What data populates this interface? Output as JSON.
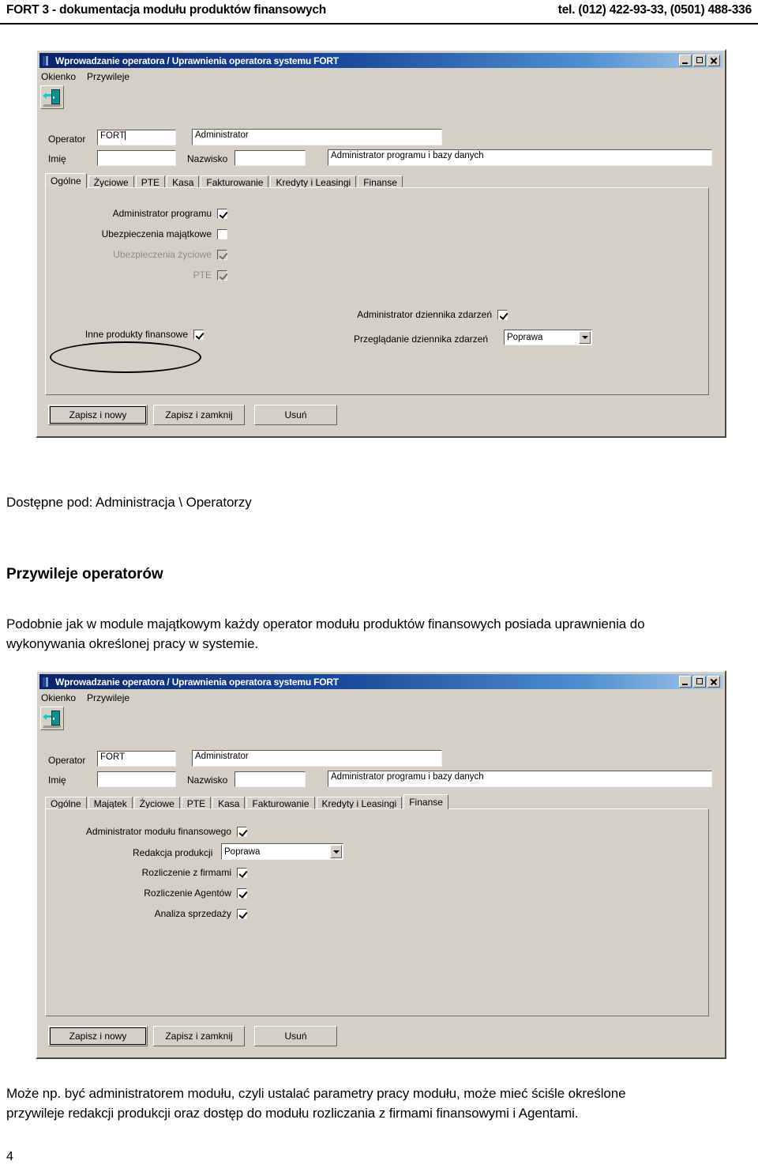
{
  "header": {
    "left_text": "FORT 3 - dokumentacja modułu produktów finansowych",
    "right_text": "tel. (012) 422-93-33, (0501) 488-336"
  },
  "dialog1": {
    "title": "Wprowadzanie operatora / Uprawnienia operatora systemu FORT",
    "titlebar_icon": "app-icon",
    "window_controls": [
      "minimize",
      "maximize",
      "close"
    ],
    "menu": [
      "Okienko",
      "Przywileje"
    ],
    "toolbar": {
      "exit_button_icon": "exit-door-icon"
    },
    "fields": {
      "operator_label": "Operator",
      "operator_code": "FORT",
      "operator_name": "Administrator",
      "imie_label": "Imię",
      "imie_value": "",
      "nazwisko_label": "Nazwisko",
      "nazwisko_value": "",
      "description": "Administrator programu i bazy danych"
    },
    "tabs": [
      {
        "label": "Ogólne",
        "active": true
      },
      {
        "label": "Życiowe",
        "active": false
      },
      {
        "label": "PTE",
        "active": false
      },
      {
        "label": "Kasa",
        "active": false
      },
      {
        "label": "Fakturowanie",
        "active": false
      },
      {
        "label": "Kredyty i Leasingi",
        "active": false
      },
      {
        "label": "Finanse",
        "active": false
      }
    ],
    "left_checks": [
      {
        "label": "Administrator programu",
        "checked": true,
        "disabled": false
      },
      {
        "label": "Ubezpieczenia majątkowe",
        "checked": false,
        "disabled": false
      },
      {
        "label": "Ubezpieczenia życiowe",
        "checked": true,
        "disabled": true
      },
      {
        "label": "PTE",
        "checked": true,
        "disabled": true
      }
    ],
    "highlighted_check": {
      "label": "Inne produkty finansowe",
      "checked": true
    },
    "right_panel": {
      "admin_log_label": "Administrator dziennika zdarzeń",
      "admin_log_checked": true,
      "view_log_label": "Przeglądanie dziennika zdarzeń",
      "view_log_value": "Poprawa"
    },
    "buttons": [
      {
        "label": "Zapisz i nowy",
        "default": true
      },
      {
        "label": "Zapisz i zamknij",
        "default": false
      },
      {
        "label": "Usuń",
        "default": false
      }
    ]
  },
  "body": {
    "available_at": "Dostępne pod: Administracja \\ Operatorzy",
    "heading": "Przywileje operatorów",
    "paragraph1_line1": "Podobnie jak w module majątkowym każdy operator modułu produktów finansowych posiada uprawnienia do",
    "paragraph1_line2": "wykonywania określonej pracy w systemie.",
    "paragraph2_line1": "Może np. być administratorem modułu, czyli ustalać parametry pracy modułu, może mieć ściśle określone",
    "paragraph2_line2": "przywileje redakcji produkcji oraz dostęp do modułu rozliczania z firmami finansowymi i Agentami."
  },
  "dialog2": {
    "title": "Wprowadzanie operatora / Uprawnienia operatora systemu FORT",
    "titlebar_icon": "app-icon",
    "window_controls": [
      "minimize",
      "maximize",
      "close"
    ],
    "menu": [
      "Okienko",
      "Przywileje"
    ],
    "toolbar": {
      "exit_button_icon": "exit-door-icon"
    },
    "fields": {
      "operator_label": "Operator",
      "operator_code": "FORT",
      "operator_name": "Administrator",
      "imie_label": "Imię",
      "imie_value": "",
      "nazwisko_label": "Nazwisko",
      "nazwisko_value": "",
      "description": "Administrator programu i bazy danych"
    },
    "tabs": [
      {
        "label": "Ogólne",
        "active": false
      },
      {
        "label": "Majątek",
        "active": false
      },
      {
        "label": "Życiowe",
        "active": false
      },
      {
        "label": "PTE",
        "active": false
      },
      {
        "label": "Kasa",
        "active": false
      },
      {
        "label": "Fakturowanie",
        "active": false
      },
      {
        "label": "Kredyty i Leasingi",
        "active": false
      },
      {
        "label": "Finanse",
        "active": true
      }
    ],
    "finance_rows": [
      {
        "type": "checkbox",
        "label": "Administrator modułu finansowego",
        "checked": true
      },
      {
        "type": "combo",
        "label": "Redakcja produkcji",
        "value": "Poprawa"
      },
      {
        "type": "checkbox",
        "label": "Rozliczenie z firmami",
        "checked": true
      },
      {
        "type": "checkbox",
        "label": "Rozliczenie Agentów",
        "checked": true
      },
      {
        "type": "checkbox",
        "label": "Analiza sprzedaży",
        "checked": true
      }
    ],
    "buttons": [
      {
        "label": "Zapisz i nowy",
        "default": true
      },
      {
        "label": "Zapisz i zamknij",
        "default": false
      },
      {
        "label": "Usuń",
        "default": false
      }
    ]
  },
  "page_number": "4"
}
